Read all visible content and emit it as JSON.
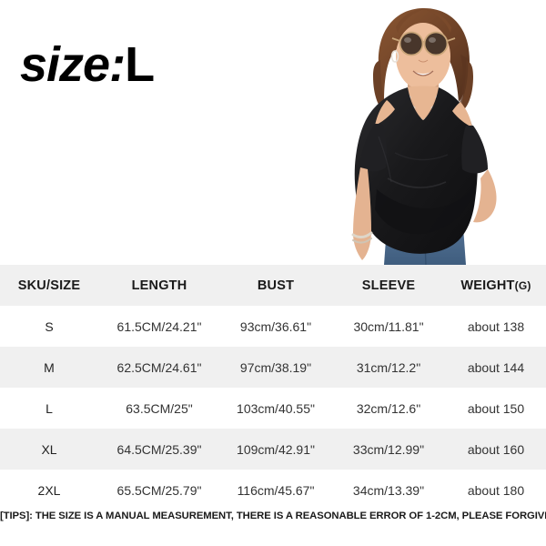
{
  "hero": {
    "title_italic": "size:",
    "title_upright": "L",
    "photo_alt": "woman-wearing-black-cold-shoulder-v-neck-twist-front-top-with-blue-jeans-and-sunglasses"
  },
  "table": {
    "headers": [
      {
        "id": "sku-size",
        "label": "SKU/SIZE"
      },
      {
        "id": "length",
        "label": "LENGTH"
      },
      {
        "id": "bust",
        "label": "BUST"
      },
      {
        "id": "sleeve",
        "label": "SLEEVE"
      },
      {
        "id": "weight",
        "label": "WEIGHT",
        "unit": "(G)"
      }
    ],
    "rows": [
      {
        "size": "S",
        "length": "61.5CM/24.21\"",
        "bust": "93cm/36.61\"",
        "sleeve": "30cm/11.81\"",
        "weight": "about 138"
      },
      {
        "size": "M",
        "length": "62.5CM/24.61\"",
        "bust": "97cm/38.19\"",
        "sleeve": "31cm/12.2\"",
        "weight": "about 144"
      },
      {
        "size": "L",
        "length": "63.5CM/25\"",
        "bust": "103cm/40.55\"",
        "sleeve": "32cm/12.6\"",
        "weight": "about 150"
      },
      {
        "size": "XL",
        "length": "64.5CM/25.39\"",
        "bust": "109cm/42.91\"",
        "sleeve": "33cm/12.99\"",
        "weight": "about 160"
      },
      {
        "size": "2XL",
        "length": "65.5CM/25.79\"",
        "bust": "116cm/45.67\"",
        "sleeve": "34cm/13.39\"",
        "weight": "about 180"
      }
    ]
  },
  "tips": {
    "text": "[TIPS]: THE SIZE IS A MANUAL MEASUREMENT, THERE IS A REASONABLE ERROR OF 1-2CM, PLEASE FORGIVE ME!"
  },
  "colors": {
    "header_row_bg": "#f0f0f0",
    "alt_row_bg": "#f0f0f0",
    "row_bg": "#ffffff",
    "text": "#333333",
    "title": "#000000",
    "garment": "#1b1b1d",
    "denim": "#4f6f93",
    "skin": "#e3b393",
    "hair": "#7a4a2b"
  }
}
